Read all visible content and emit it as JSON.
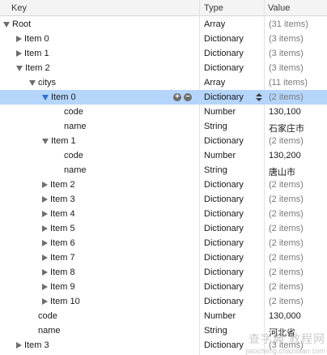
{
  "header": {
    "key": "Key",
    "type": "Type",
    "value": "Value"
  },
  "rows": [
    {
      "indent": 0,
      "toggle": "open",
      "key": "Root",
      "type": "Array",
      "value": "(31 items)",
      "muted": true
    },
    {
      "indent": 1,
      "toggle": "closed",
      "key": "Item 0",
      "type": "Dictionary",
      "value": "(3 items)",
      "muted": true
    },
    {
      "indent": 1,
      "toggle": "closed",
      "key": "Item 1",
      "type": "Dictionary",
      "value": "(3 items)",
      "muted": true
    },
    {
      "indent": 1,
      "toggle": "open",
      "key": "Item 2",
      "type": "Dictionary",
      "value": "(3 items)",
      "muted": true
    },
    {
      "indent": 2,
      "toggle": "open",
      "key": "citys",
      "type": "Array",
      "value": "(11 items)",
      "muted": true
    },
    {
      "indent": 3,
      "toggle": "open",
      "key": "Item 0",
      "type": "Dictionary",
      "value": "(2 items)",
      "muted": true,
      "selected": true
    },
    {
      "indent": 4,
      "toggle": "none",
      "key": "code",
      "type": "Number",
      "value": "130,100",
      "muted": false
    },
    {
      "indent": 4,
      "toggle": "none",
      "key": "name",
      "type": "String",
      "value": "石家庄市",
      "muted": false
    },
    {
      "indent": 3,
      "toggle": "open",
      "key": "Item 1",
      "type": "Dictionary",
      "value": "(2 items)",
      "muted": true
    },
    {
      "indent": 4,
      "toggle": "none",
      "key": "code",
      "type": "Number",
      "value": "130,200",
      "muted": false
    },
    {
      "indent": 4,
      "toggle": "none",
      "key": "name",
      "type": "String",
      "value": "唐山市",
      "muted": false
    },
    {
      "indent": 3,
      "toggle": "closed",
      "key": "Item 2",
      "type": "Dictionary",
      "value": "(2 items)",
      "muted": true
    },
    {
      "indent": 3,
      "toggle": "closed",
      "key": "Item 3",
      "type": "Dictionary",
      "value": "(2 items)",
      "muted": true
    },
    {
      "indent": 3,
      "toggle": "closed",
      "key": "Item 4",
      "type": "Dictionary",
      "value": "(2 items)",
      "muted": true
    },
    {
      "indent": 3,
      "toggle": "closed",
      "key": "Item 5",
      "type": "Dictionary",
      "value": "(2 items)",
      "muted": true
    },
    {
      "indent": 3,
      "toggle": "closed",
      "key": "Item 6",
      "type": "Dictionary",
      "value": "(2 items)",
      "muted": true
    },
    {
      "indent": 3,
      "toggle": "closed",
      "key": "Item 7",
      "type": "Dictionary",
      "value": "(2 items)",
      "muted": true
    },
    {
      "indent": 3,
      "toggle": "closed",
      "key": "Item 8",
      "type": "Dictionary",
      "value": "(2 items)",
      "muted": true
    },
    {
      "indent": 3,
      "toggle": "closed",
      "key": "Item 9",
      "type": "Dictionary",
      "value": "(2 items)",
      "muted": true
    },
    {
      "indent": 3,
      "toggle": "closed",
      "key": "Item 10",
      "type": "Dictionary",
      "value": "(2 items)",
      "muted": true
    },
    {
      "indent": 2,
      "toggle": "none",
      "key": "code",
      "type": "Number",
      "value": "130,000",
      "muted": false
    },
    {
      "indent": 2,
      "toggle": "none",
      "key": "name",
      "type": "String",
      "value": "河北省",
      "muted": false
    },
    {
      "indent": 1,
      "toggle": "closed",
      "key": "Item 3",
      "type": "Dictionary",
      "value": "(3 items)",
      "muted": true
    }
  ],
  "selected_row_controls": {
    "add_icon": "plus-circle-icon",
    "add_glyph": "+",
    "remove_icon": "minus-circle-icon",
    "remove_glyph": "−",
    "type_stepper_icon": "updown-stepper-icon"
  },
  "colors": {
    "selection": "#b5d5fb",
    "header_bg": "#f4f4f4",
    "muted_value": "#7a7a7a"
  },
  "watermark": {
    "line1": "查字典 教程网",
    "line2": "jiaocheng.chazidian.com"
  }
}
